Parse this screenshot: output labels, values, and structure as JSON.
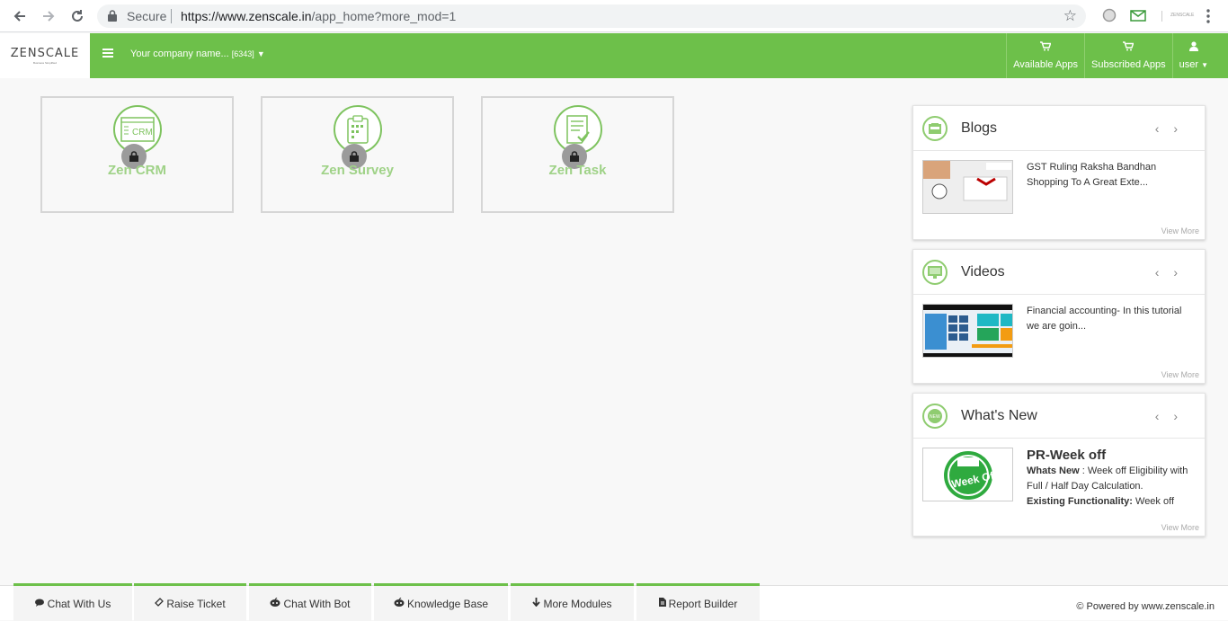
{
  "browser": {
    "secure_label": "Secure",
    "url_host": "https://www.zenscale.in",
    "url_path": "/app_home?more_mod=1"
  },
  "header": {
    "logo_text": "ZENSCALE",
    "logo_tagline": "Business Simplified",
    "company_name": "Your company name...",
    "company_id": "[6343]",
    "available_apps": "Available Apps",
    "subscribed_apps": "Subscribed Apps",
    "user": "user"
  },
  "apps": [
    {
      "title": "Zen CRM",
      "icon": "crm-icon",
      "locked": true
    },
    {
      "title": "Zen Survey",
      "icon": "clipboard-icon",
      "locked": true
    },
    {
      "title": "Zen Task",
      "icon": "task-icon",
      "locked": true
    }
  ],
  "panels": {
    "blogs": {
      "title": "Blogs",
      "text": "GST Ruling Raksha Bandhan Shopping To A Great Exte...",
      "view_more": "View More"
    },
    "videos": {
      "title": "Videos",
      "text": "Financial accounting- In this tutorial we are goin...",
      "view_more": "View More"
    },
    "whats_new": {
      "title": "What's New",
      "item_title": "PR-Week off",
      "label1": "Whats New",
      "text1": " : Week off Eligibility with Full / Half Day Calculation.",
      "label2": "Existing Functionality:",
      "text2": " Week off eligibility was calculated...",
      "badge": "Week Off",
      "view_more": "View More"
    }
  },
  "footer": {
    "buttons": [
      "Chat With Us",
      "Raise Ticket",
      "Chat With Bot",
      "Knowledge Base",
      "More Modules",
      "Report Builder"
    ],
    "powered": "© Powered by www.zenscale.in"
  },
  "colors": {
    "brand_green": "#6dc04a",
    "card_title": "#9fd287"
  }
}
